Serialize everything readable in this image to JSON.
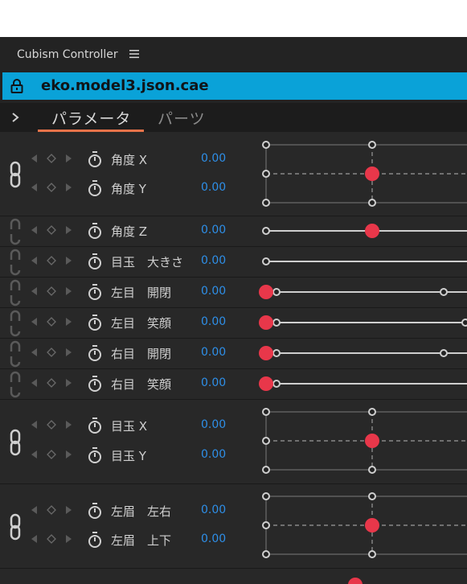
{
  "panel": {
    "title": "Cubism Controller",
    "model_name": "eko.model3.json.cae",
    "tabs": [
      {
        "label": "パラメータ",
        "active": true
      },
      {
        "label": "パーツ",
        "active": false
      }
    ]
  },
  "parameters": [
    {
      "name": "角度 X",
      "value": "0.00"
    },
    {
      "name": "角度 Y",
      "value": "0.00"
    },
    {
      "name": "角度 Z",
      "value": "0.00"
    },
    {
      "name": "目玉　大きさ",
      "value": "0.00"
    },
    {
      "name": "左目　開閉",
      "value": "0.00"
    },
    {
      "name": "左目　笑顔",
      "value": "0.00"
    },
    {
      "name": "右目　開閉",
      "value": "0.00"
    },
    {
      "name": "右目　笑顔",
      "value": "0.00"
    },
    {
      "name": "目玉 X",
      "value": "0.00"
    },
    {
      "name": "目玉 Y",
      "value": "0.00"
    },
    {
      "name": "左眉　左右",
      "value": "0.00"
    },
    {
      "name": "左眉　上下",
      "value": "0.00"
    }
  ],
  "colors": {
    "accent": "#0aa2d8",
    "value_text": "#2e8fe8",
    "handle": "#e8374a",
    "tab_underline": "#e8734a"
  }
}
